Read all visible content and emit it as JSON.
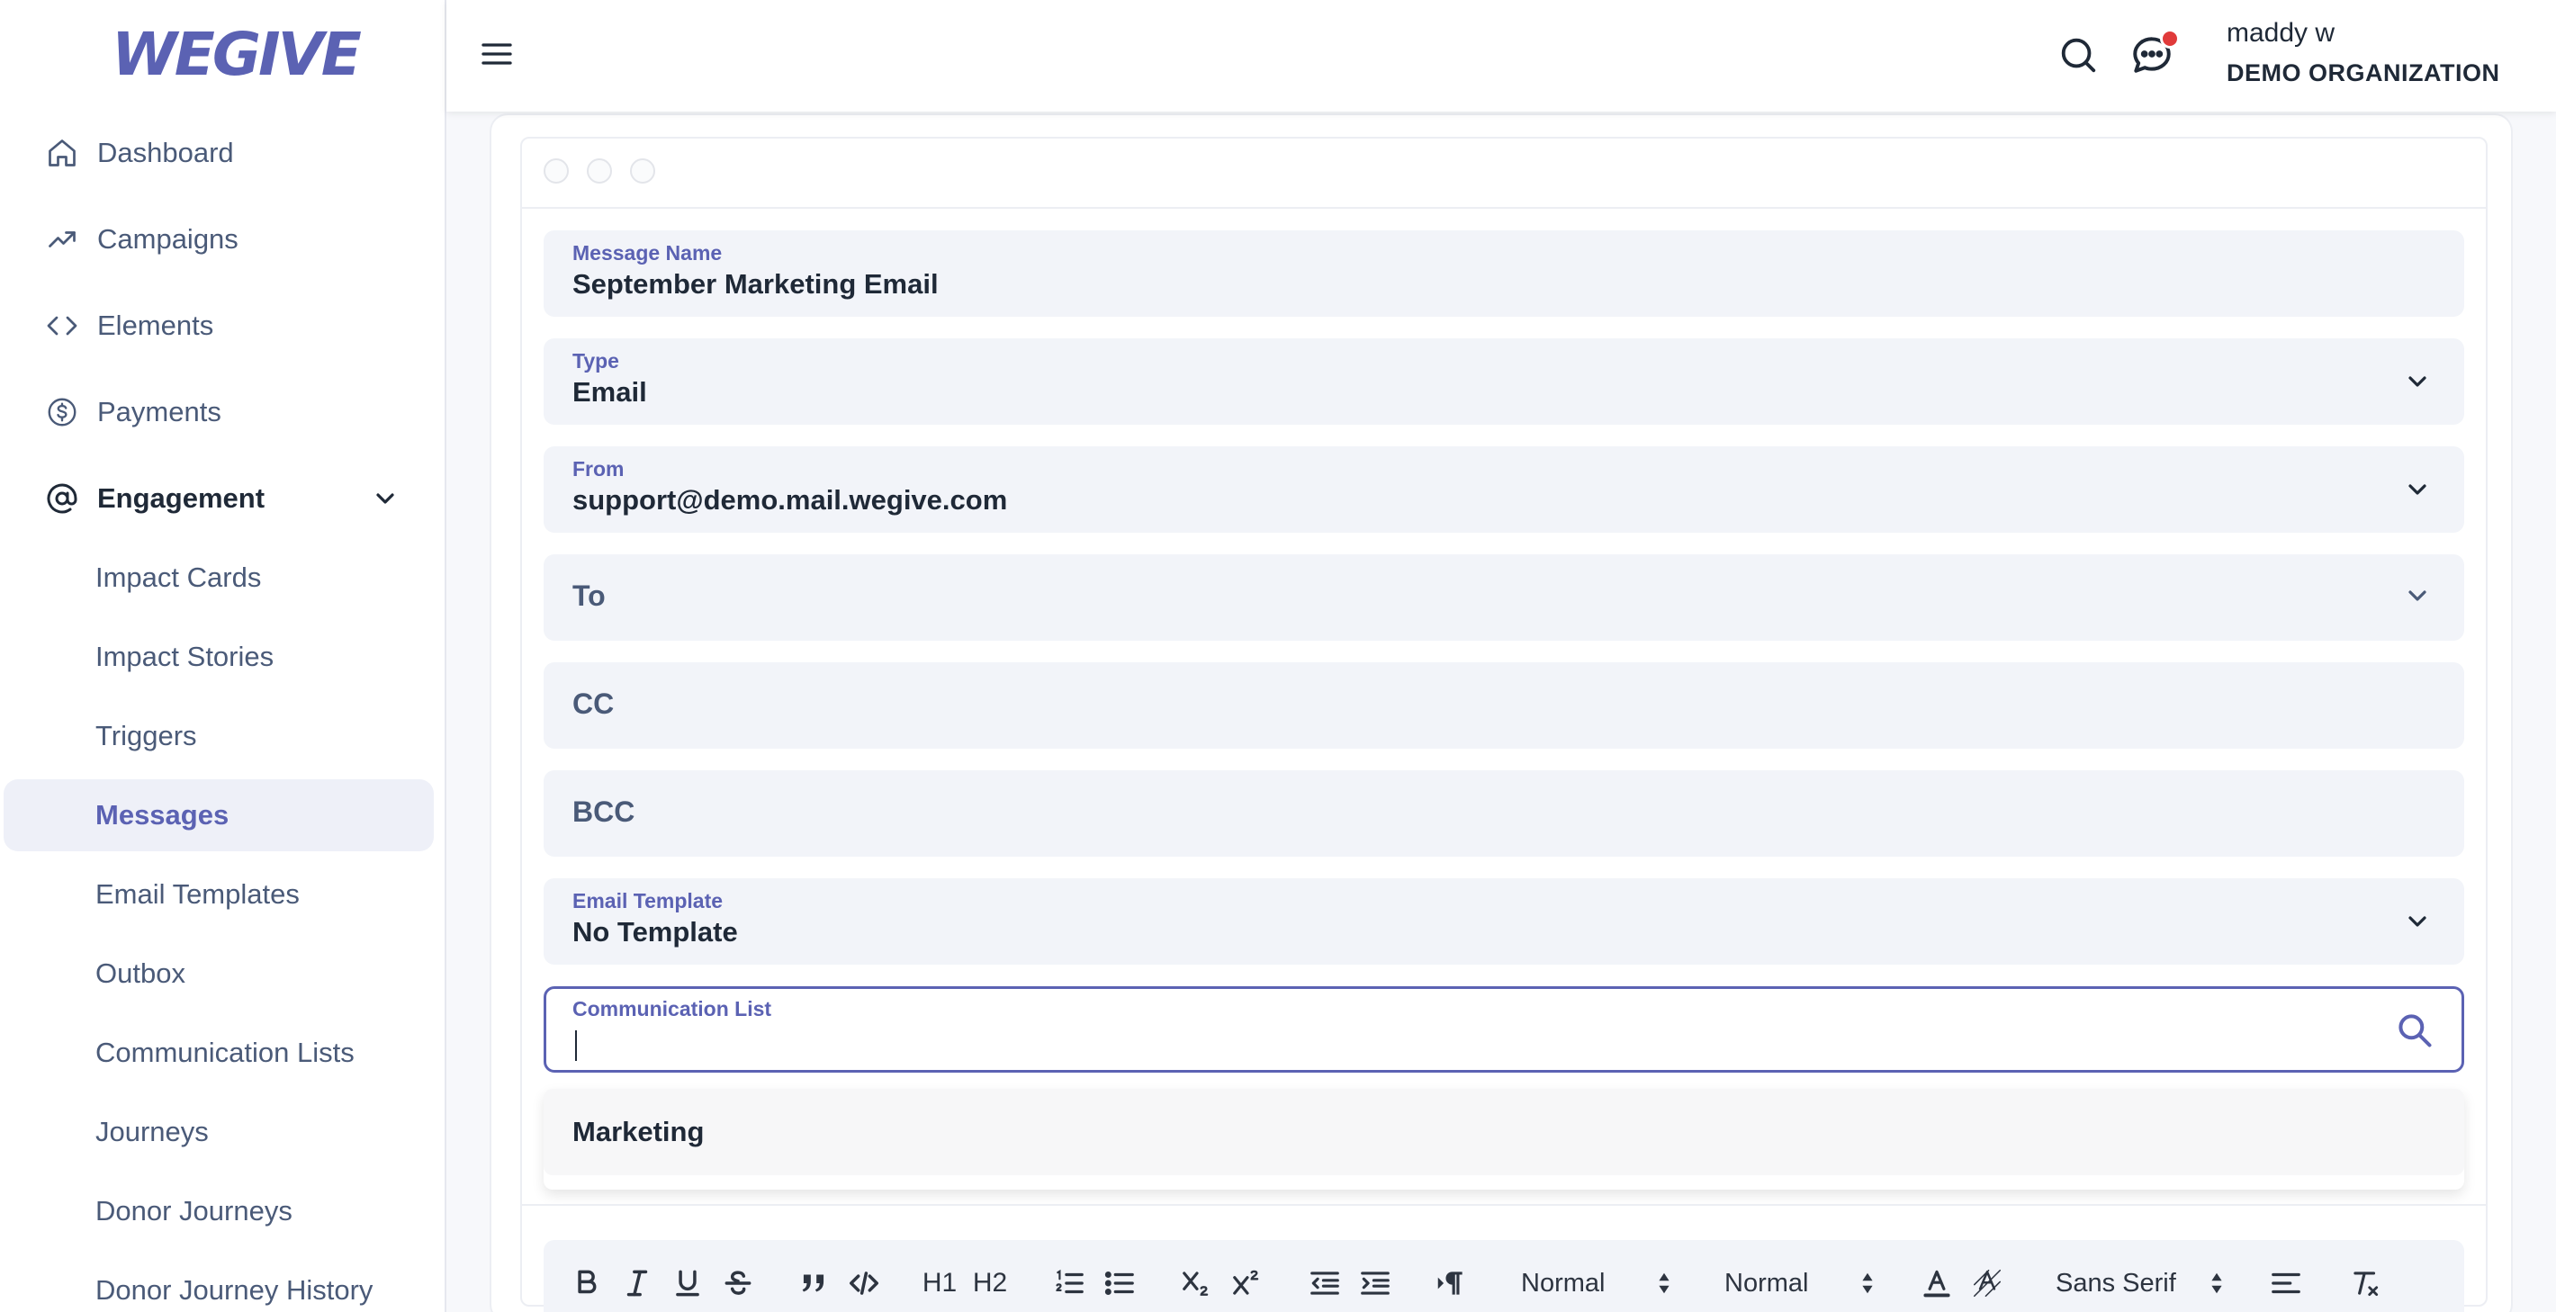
{
  "brand": {
    "logo_text": "WEGIVE",
    "accent": "#5b62b3"
  },
  "sidebar": {
    "items": [
      {
        "label": "Dashboard",
        "icon": "home-icon"
      },
      {
        "label": "Campaigns",
        "icon": "trending-up-icon"
      },
      {
        "label": "Elements",
        "icon": "code-icon"
      },
      {
        "label": "Payments",
        "icon": "dollar-circle-icon"
      },
      {
        "label": "Engagement",
        "icon": "at-sign-icon",
        "expanded": true
      }
    ],
    "sub_items": [
      {
        "label": "Impact Cards"
      },
      {
        "label": "Impact Stories"
      },
      {
        "label": "Triggers"
      },
      {
        "label": "Messages",
        "active": true
      },
      {
        "label": "Email Templates"
      },
      {
        "label": "Outbox"
      },
      {
        "label": "Communication Lists"
      },
      {
        "label": "Journeys"
      },
      {
        "label": "Donor Journeys"
      },
      {
        "label": "Donor Journey History"
      }
    ]
  },
  "header": {
    "user_name": "maddy w",
    "organization": "DEMO ORGANIZATION",
    "notification_color": "#e03a3a"
  },
  "form": {
    "message_name": {
      "label": "Message Name",
      "value": "September Marketing Email"
    },
    "type": {
      "label": "Type",
      "value": "Email"
    },
    "from": {
      "label": "From",
      "value": "support@demo.mail.wegive.com"
    },
    "to": {
      "placeholder": "To"
    },
    "cc": {
      "placeholder": "CC"
    },
    "bcc": {
      "placeholder": "BCC"
    },
    "email_template": {
      "label": "Email Template",
      "value": "No Template"
    },
    "communication_list": {
      "label": "Communication List",
      "value": ""
    },
    "communication_options": [
      "Marketing"
    ]
  },
  "editor_toolbar": {
    "heading1": "H1",
    "heading2": "H2",
    "size_select": "Normal",
    "header_select": "Normal",
    "font_select": "Sans Serif"
  }
}
